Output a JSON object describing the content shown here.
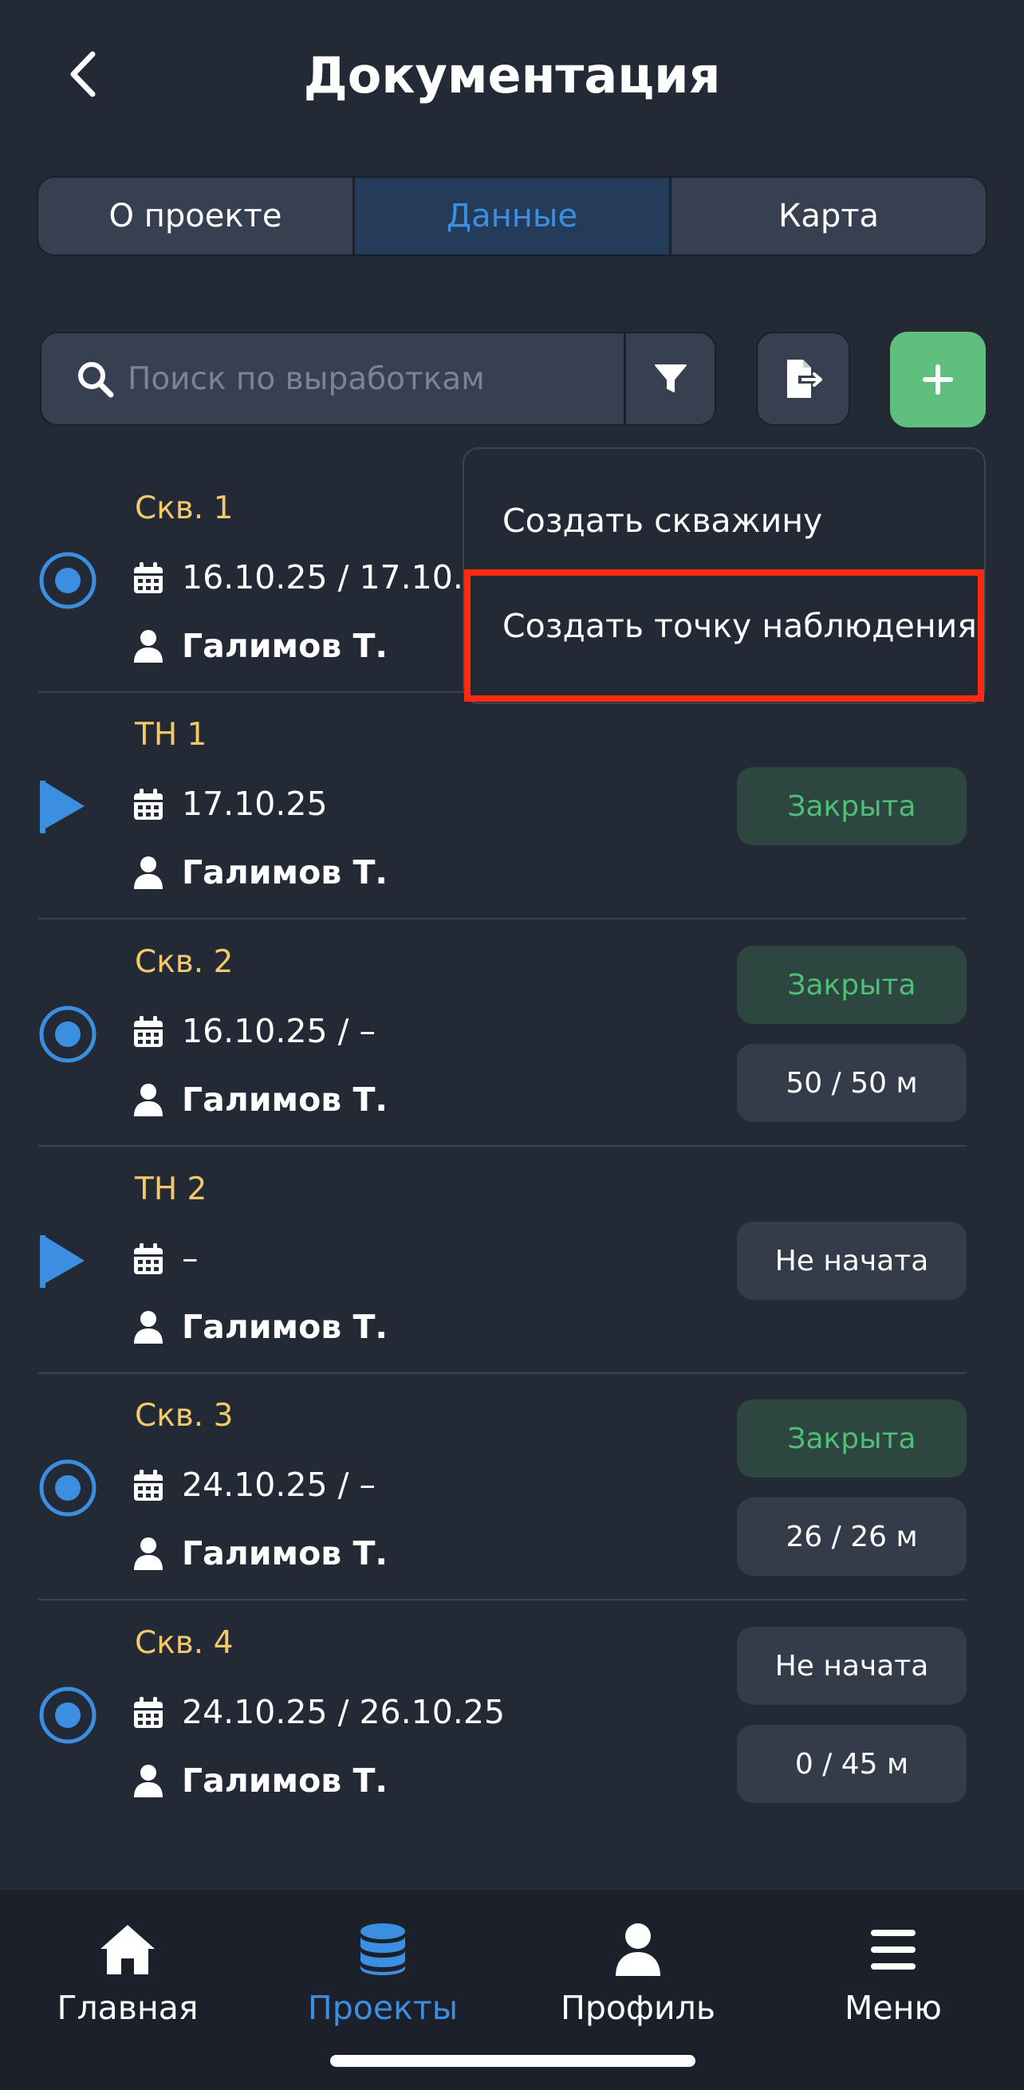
{
  "header": {
    "title": "Документация"
  },
  "tabs": [
    {
      "label": "О проекте",
      "active": false
    },
    {
      "label": "Данные",
      "active": true
    },
    {
      "label": "Карта",
      "active": false
    }
  ],
  "search": {
    "placeholder": "Поиск по выработкам",
    "value": ""
  },
  "dropdown": {
    "items": [
      {
        "label": "Создать скважину"
      },
      {
        "label": "Создать точку наблюдения",
        "highlighted": true
      }
    ]
  },
  "items": [
    {
      "type": "well",
      "title": "Скв. 1",
      "date": "16.10.25 / 17.10.25",
      "user": "Галимов Т.",
      "badges": []
    },
    {
      "type": "point",
      "title": "ТН 1",
      "date": "17.10.25",
      "user": "Галимов Т.",
      "badges": [
        {
          "text": "Закрыта",
          "kind": "closed"
        }
      ]
    },
    {
      "type": "well",
      "title": "Скв. 2",
      "date": "16.10.25 / –",
      "user": "Галимов Т.",
      "badges": [
        {
          "text": "Закрыта",
          "kind": "closed"
        },
        {
          "text": "50 / 50 м",
          "kind": "depth"
        }
      ]
    },
    {
      "type": "point",
      "title": "ТН 2",
      "date": "–",
      "user": "Галимов Т.",
      "badges": [
        {
          "text": "Не начата",
          "kind": "neutral"
        }
      ]
    },
    {
      "type": "well",
      "title": "Скв. 3",
      "date": "24.10.25 / –",
      "user": "Галимов Т.",
      "badges": [
        {
          "text": "Закрыта",
          "kind": "closed"
        },
        {
          "text": "26 / 26 м",
          "kind": "depth"
        }
      ]
    },
    {
      "type": "well",
      "title": "Скв. 4",
      "date": "24.10.25 / 26.10.25",
      "user": "Галимов Т.",
      "badges": [
        {
          "text": "Не начата",
          "kind": "neutral"
        },
        {
          "text": "0 / 45 м",
          "kind": "depth"
        }
      ]
    }
  ],
  "bottom_nav": [
    {
      "label": "Главная",
      "icon": "home-icon",
      "active": false
    },
    {
      "label": "Проекты",
      "icon": "database-icon",
      "active": true
    },
    {
      "label": "Профиль",
      "icon": "user-icon",
      "active": false
    },
    {
      "label": "Меню",
      "icon": "menu-icon",
      "active": false
    }
  ],
  "colors": {
    "background": "#232a36",
    "accent": "#3c8fe0",
    "add_button": "#5fbf7f",
    "title_yellow": "#f5c96a",
    "closed_text": "#4fbf77",
    "highlight": "#ff2a10"
  }
}
